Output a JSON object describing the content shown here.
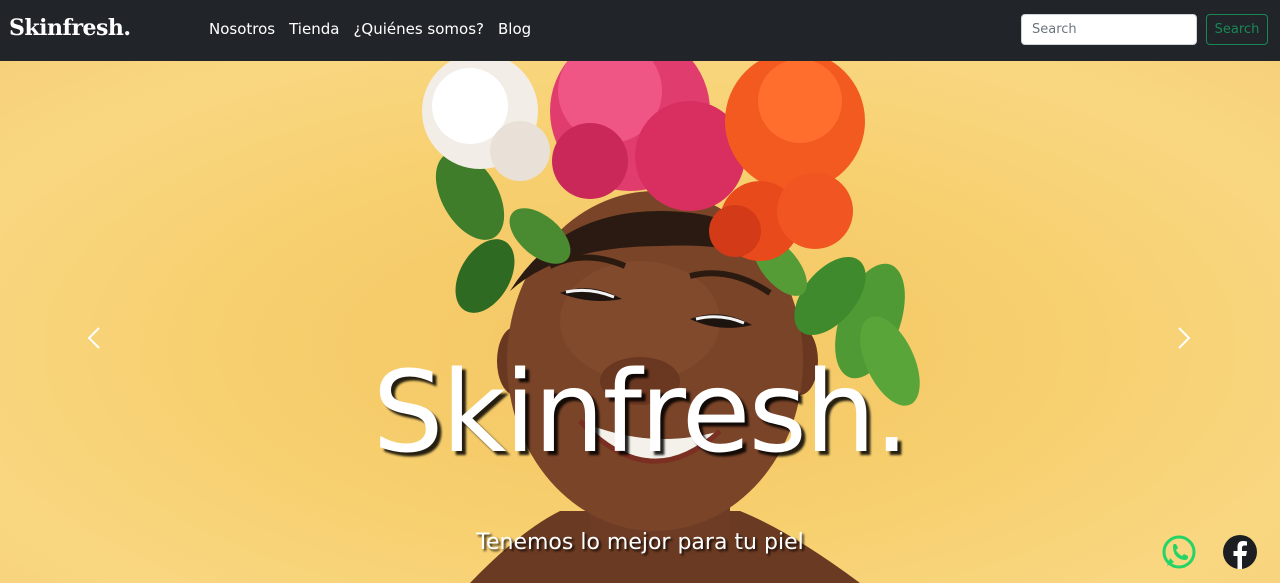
{
  "navbar": {
    "brand": "Skinfresh.",
    "links": [
      "Nosotros",
      "Tienda",
      "¿Quiénes somos?",
      "Blog"
    ],
    "search": {
      "placeholder": "Search",
      "button_label": "Search"
    }
  },
  "hero": {
    "title": "Skinfresh.",
    "subtitle": "Tenemos lo mejor para tu piel"
  },
  "colors": {
    "navbar_bg": "#212529",
    "hero_bg": "#f7cf6e",
    "search_button": "#198754",
    "whatsapp": "#25d366",
    "facebook": "#1c1e21"
  },
  "icons": [
    "chevron-left-icon",
    "chevron-right-icon",
    "whatsapp-icon",
    "facebook-icon"
  ]
}
